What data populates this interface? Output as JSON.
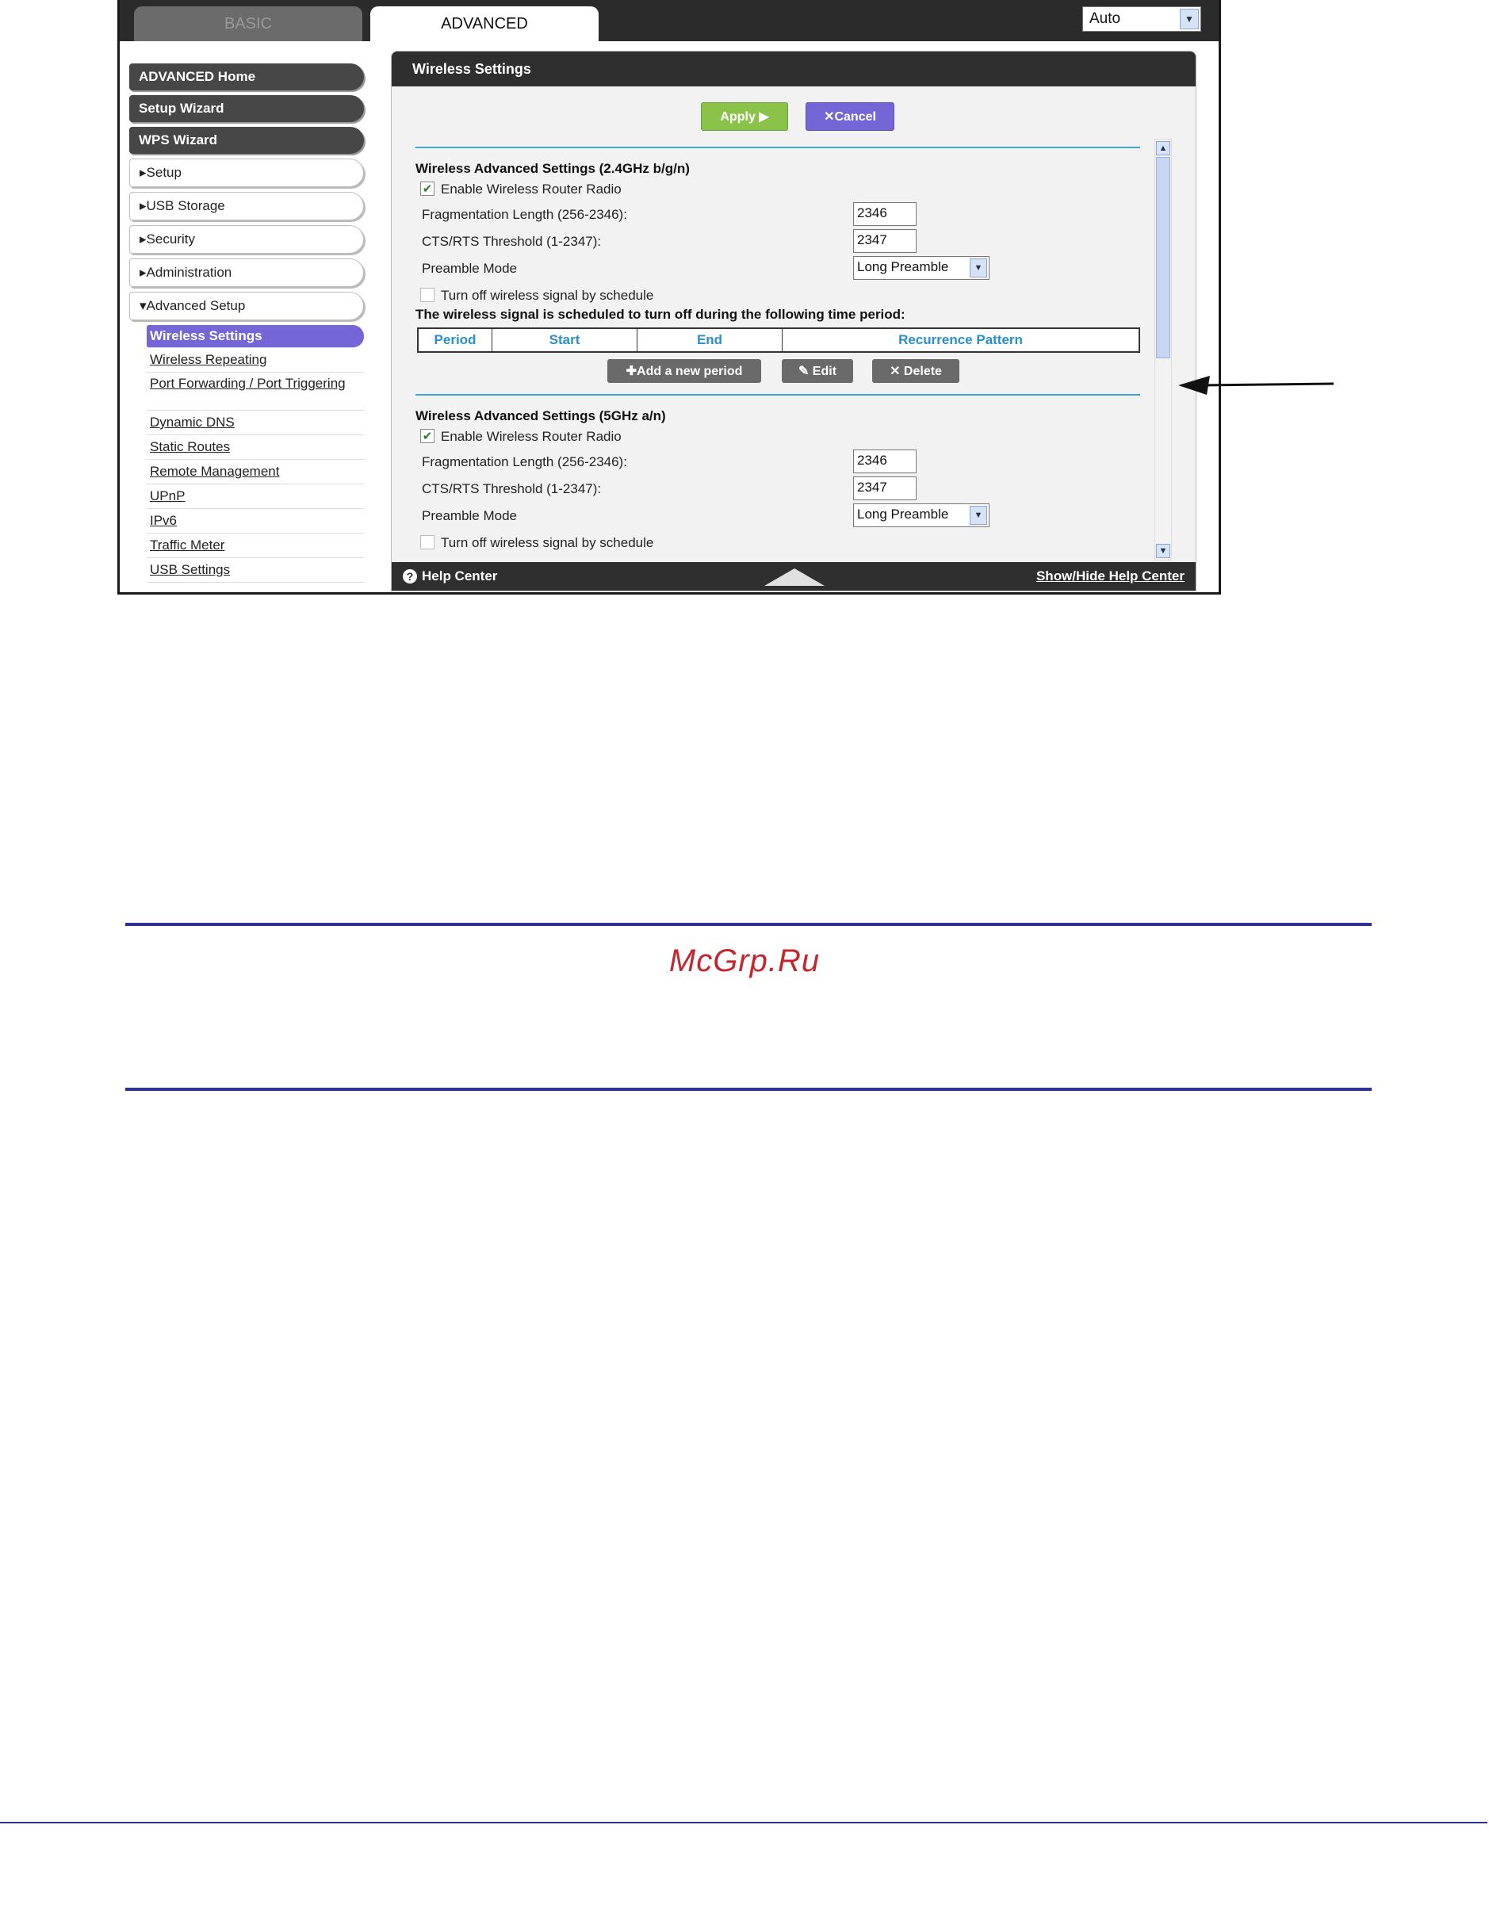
{
  "tabs": {
    "basic": "BASIC",
    "advanced": "ADVANCED"
  },
  "language": {
    "selected": "Auto"
  },
  "sidebar": {
    "buttons": [
      "ADVANCED Home",
      "Setup Wizard",
      "WPS Wizard"
    ],
    "menus": [
      "▸Setup",
      "▸USB Storage",
      "▸Security",
      "▸Administration",
      "▾Advanced Setup"
    ],
    "sub": [
      "Wireless Settings",
      "Wireless Repeating",
      "Port Forwarding / Port Triggering",
      "Dynamic DNS",
      "Static Routes",
      "Remote Management",
      "UPnP",
      "IPv6",
      "Traffic Meter",
      "USB Settings"
    ]
  },
  "panel": {
    "title": "Wireless Settings",
    "apply": "Apply ▶",
    "cancel": "✕Cancel",
    "band24": {
      "heading": "Wireless Advanced Settings (2.4GHz b/g/n)",
      "enable": "Enable Wireless Router Radio",
      "frag_label": "Fragmentation Length (256-2346):",
      "frag_value": "2346",
      "cts_label": "CTS/RTS Threshold (1-2347):",
      "cts_value": "2347",
      "preamble_label": "Preamble Mode",
      "preamble_value": "Long Preamble",
      "schedule": "Turn off wireless signal by schedule",
      "note": "The wireless signal is scheduled to turn off during the following time period:"
    },
    "table": {
      "cols": [
        "Period",
        "Start",
        "End",
        "Recurrence Pattern"
      ]
    },
    "actions": {
      "add": "✚Add a new period",
      "edit": "✎ Edit",
      "delete": "✕ Delete"
    },
    "band5": {
      "heading": "Wireless Advanced Settings (5GHz a/n)",
      "enable": "Enable Wireless Router Radio",
      "frag_label": "Fragmentation Length (256-2346):",
      "frag_value": "2346",
      "cts_label": "CTS/RTS Threshold (1-2347):",
      "cts_value": "2347",
      "preamble_label": "Preamble Mode",
      "preamble_value": "Long Preamble",
      "schedule": "Turn off wireless signal by schedule"
    }
  },
  "help": {
    "left": "Help Center",
    "right": "Show/Hide Help Center"
  },
  "brand": "McGrp.Ru",
  "colors": {
    "accent": "#7466d6",
    "apply": "#8bc34a",
    "rule": "#2e3192",
    "brand": "#c1272d"
  }
}
